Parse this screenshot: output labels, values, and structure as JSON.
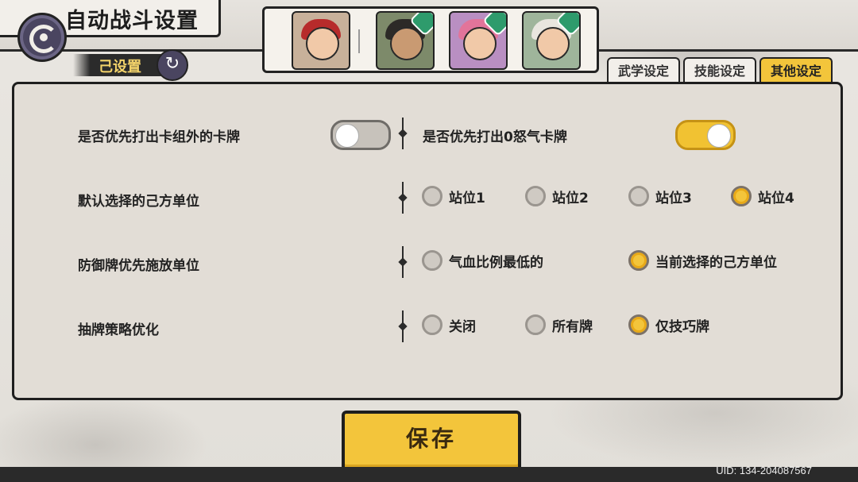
{
  "header": {
    "title": "自动战斗设置",
    "preset_tag": "己设置"
  },
  "tabs": [
    {
      "label": "武学设定",
      "active": false
    },
    {
      "label": "技能设定",
      "active": false
    },
    {
      "label": "其他设定",
      "active": true
    }
  ],
  "settings": {
    "row1_left_label": "是否优先打出卡组外的卡牌",
    "row1_left_toggle": "off",
    "row1_right_label": "是否优先打出0怒气卡牌",
    "row1_right_toggle": "on",
    "row2_label": "默认选择的己方单位",
    "row2_options": [
      "站位1",
      "站位2",
      "站位3",
      "站位4"
    ],
    "row2_selected": "站位4",
    "row3_label": "防御牌优先施放单位",
    "row3_options": [
      "气血比例最低的",
      "当前选择的己方单位"
    ],
    "row3_selected": "当前选择的己方单位",
    "row4_label": "抽牌策略优化",
    "row4_options": [
      "关闭",
      "所有牌",
      "仅技巧牌"
    ],
    "row4_selected": "仅技巧牌"
  },
  "save_label": "保存",
  "uid": "UID: 134-204087567",
  "colors": {
    "accent": "#f3c53b",
    "panel": "#e2ddd6",
    "border": "#1e1e1e"
  }
}
